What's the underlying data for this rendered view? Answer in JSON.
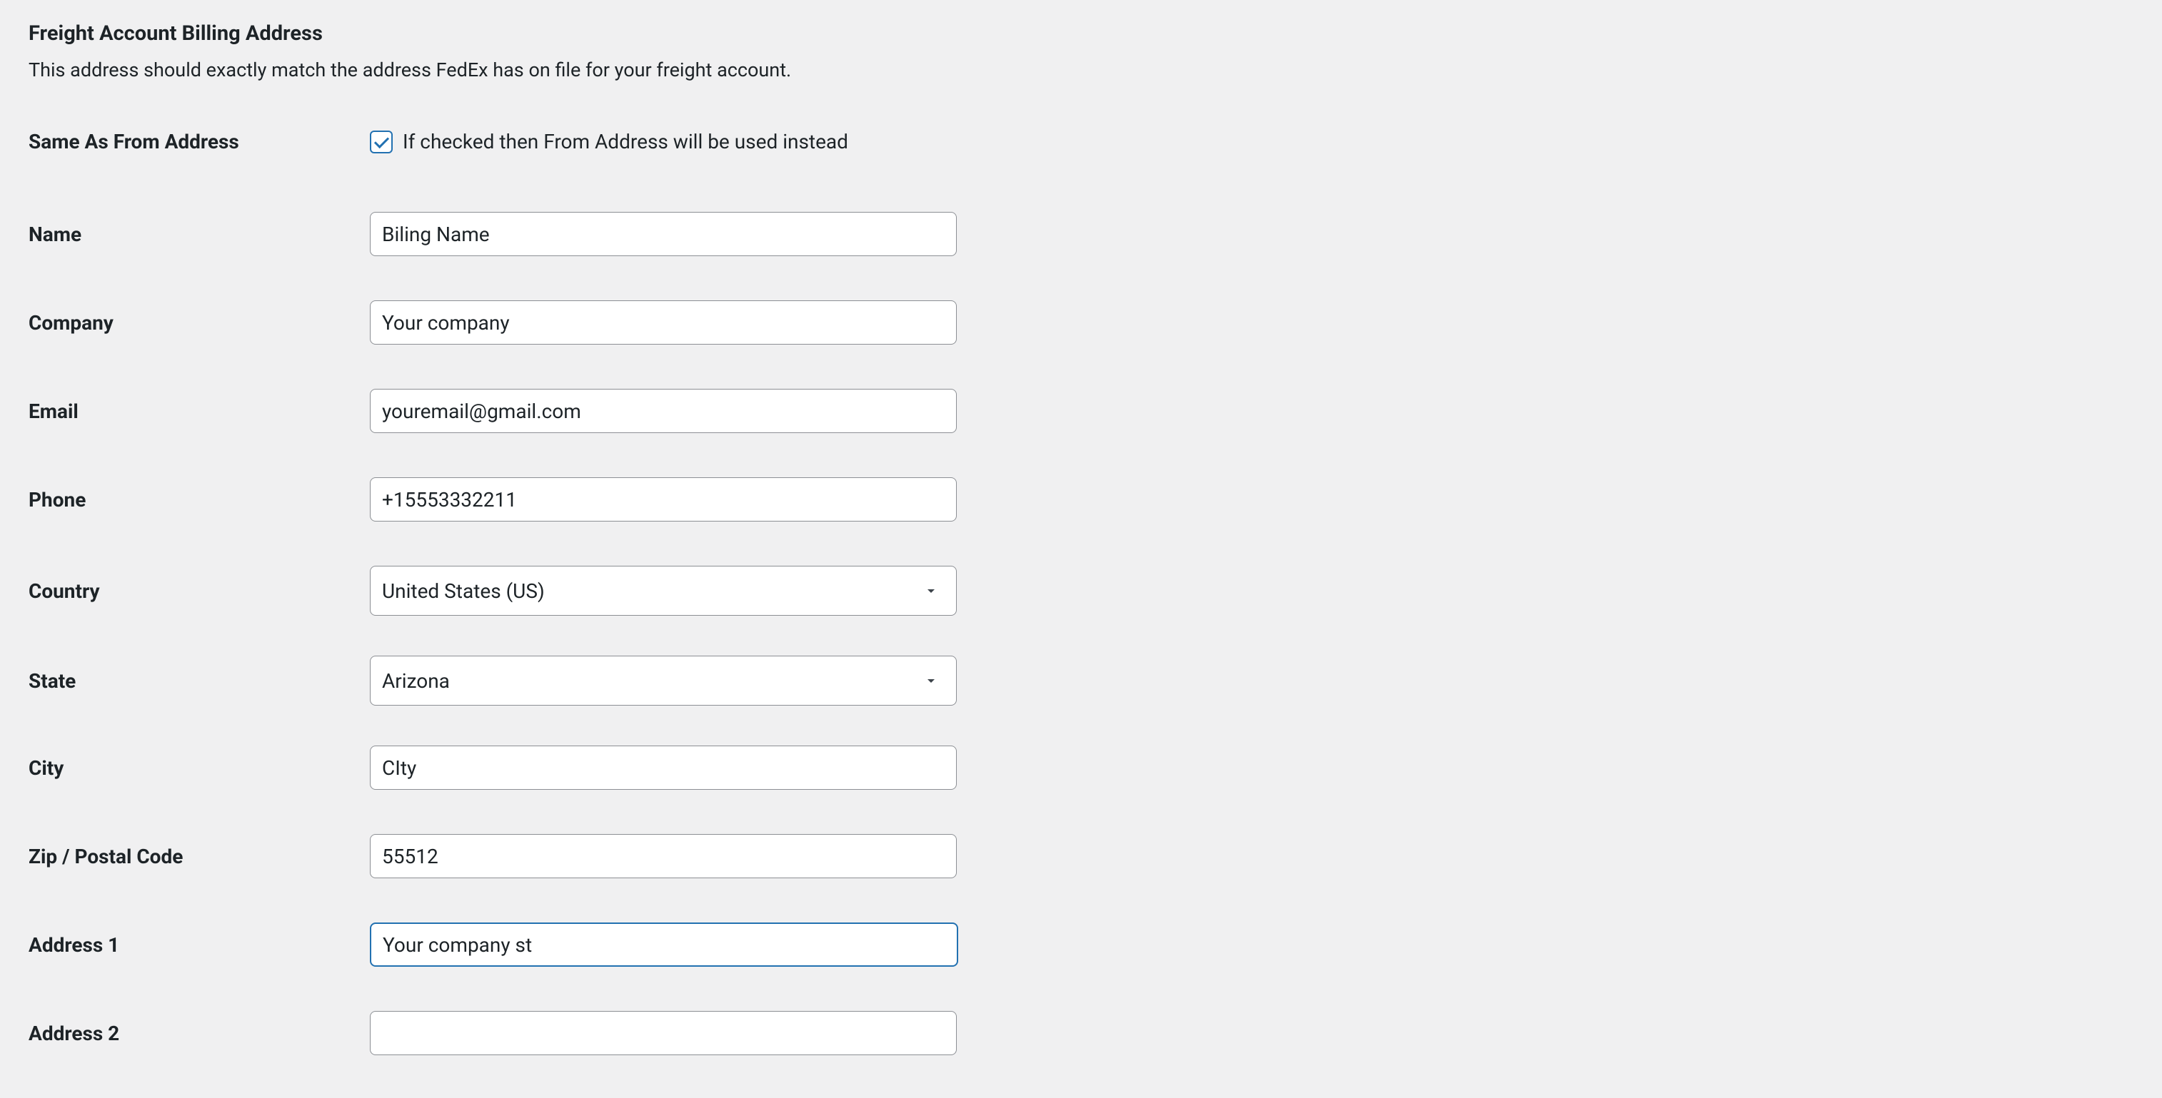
{
  "section": {
    "title": "Freight Account Billing Address",
    "description": "This address should exactly match the address FedEx has on file for your freight account."
  },
  "labels": {
    "same_as_from": "Same As From Address",
    "name": "Name",
    "company": "Company",
    "email": "Email",
    "phone": "Phone",
    "country": "Country",
    "state": "State",
    "city": "City",
    "zip": "Zip / Postal Code",
    "address1": "Address 1",
    "address2": "Address 2"
  },
  "checkbox": {
    "same_as_from_description": "If checked then From Address will be used instead"
  },
  "values": {
    "name": "Biling Name",
    "company": "Your company",
    "email": "youremail@gmail.com",
    "phone": "+15553332211",
    "country": "United States (US)",
    "state": "Arizona",
    "city": "CIty",
    "zip": "55512",
    "address1": "Your company st",
    "address2": ""
  }
}
